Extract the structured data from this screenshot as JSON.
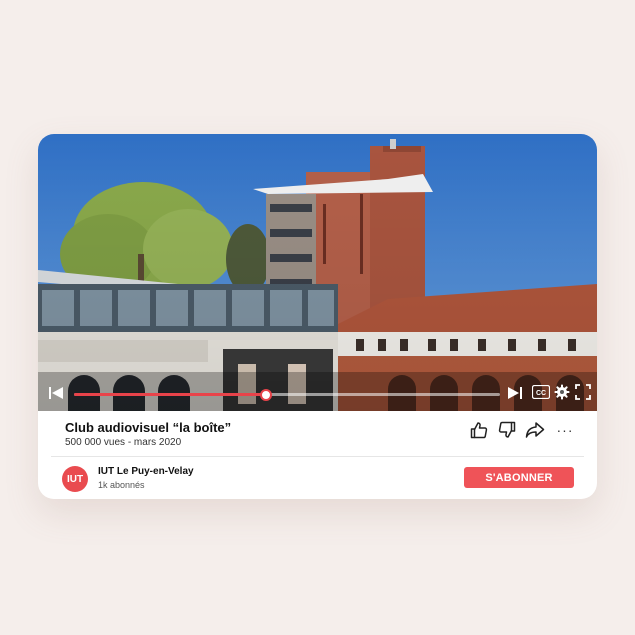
{
  "video": {
    "title": "Club audiovisuel “la boîte”",
    "meta": "500 000 vues - mars 2020",
    "progress": 0.45,
    "controls": {
      "prev_icon": "skip-previous-icon",
      "next_icon": "skip-next-icon",
      "cc_label": "CC",
      "settings_icon": "gear-icon",
      "fullscreen_icon": "fullscreen-icon"
    }
  },
  "actions": {
    "like_icon": "thumbs-up-icon",
    "dislike_icon": "thumbs-down-icon",
    "share_icon": "share-icon",
    "more_label": "···"
  },
  "channel": {
    "avatar_text": "IUT",
    "name": "IUT Le Puy-en-Velay",
    "subscribers": "1k abonnés",
    "subscribe_label": "S'ABONNER"
  },
  "colors": {
    "accent": "#e8434a",
    "subscribe_button": "#ef5358",
    "avatar": "#e94b4f",
    "page_background": "#f5eeeb"
  }
}
